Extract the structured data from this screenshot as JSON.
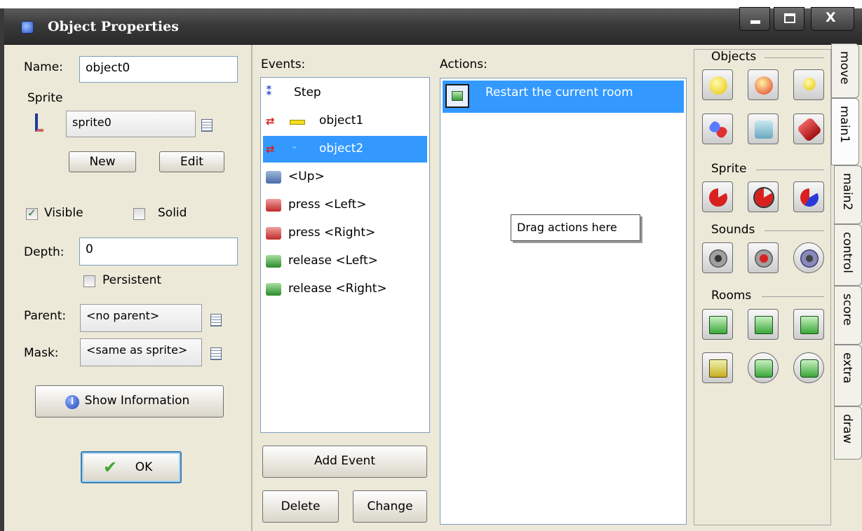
{
  "window": {
    "title": "Object Properties",
    "controls": {
      "minimize": "–",
      "maximize": "□",
      "close": "X"
    }
  },
  "left": {
    "name_label": "Name:",
    "name_value": "object0",
    "sprite_label": "Sprite",
    "sprite_value": "sprite0",
    "new_label": "New",
    "edit_label": "Edit",
    "visible_label": "Visible",
    "visible_checked": true,
    "solid_label": "Solid",
    "solid_checked": false,
    "depth_label": "Depth:",
    "depth_value": "0",
    "persistent_label": "Persistent",
    "persistent_checked": false,
    "parent_label": "Parent:",
    "parent_value": "<no parent>",
    "mask_label": "Mask:",
    "mask_value": "<same as sprite>",
    "show_info_label": "Show Information",
    "ok_label": "OK"
  },
  "events": {
    "header": "Events:",
    "items": [
      {
        "label": "Step",
        "icon": "step-icon"
      },
      {
        "label": "object1",
        "icon": "collision-icon"
      },
      {
        "label": "object2",
        "icon": "collision-icon",
        "selected": true
      },
      {
        "label": "<Up>",
        "icon": "keyboard-icon"
      },
      {
        "label": "press <Left>",
        "icon": "key-press-icon"
      },
      {
        "label": "press <Right>",
        "icon": "key-press-icon"
      },
      {
        "label": "release <Left>",
        "icon": "key-release-icon"
      },
      {
        "label": "release <Right>",
        "icon": "key-release-icon"
      }
    ],
    "add_event_label": "Add Event",
    "delete_label": "Delete",
    "change_label": "Change"
  },
  "actions": {
    "header": "Actions:",
    "items": [
      {
        "label": "Restart the current room",
        "icon": "room-restart-icon",
        "selected": true
      }
    ],
    "drag_hint": "Drag actions here"
  },
  "palette": {
    "sections": {
      "objects": "Objects",
      "sprite": "Sprite",
      "sounds": "Sounds",
      "rooms": "Rooms"
    },
    "tabs": [
      "move",
      "main1",
      "main2",
      "control",
      "score",
      "extra",
      "draw"
    ],
    "active_tab": "main1"
  },
  "colors": {
    "selection": "#3399ff",
    "titlebar": "#3a3a3a",
    "dialog_bg": "#ece9d8"
  }
}
